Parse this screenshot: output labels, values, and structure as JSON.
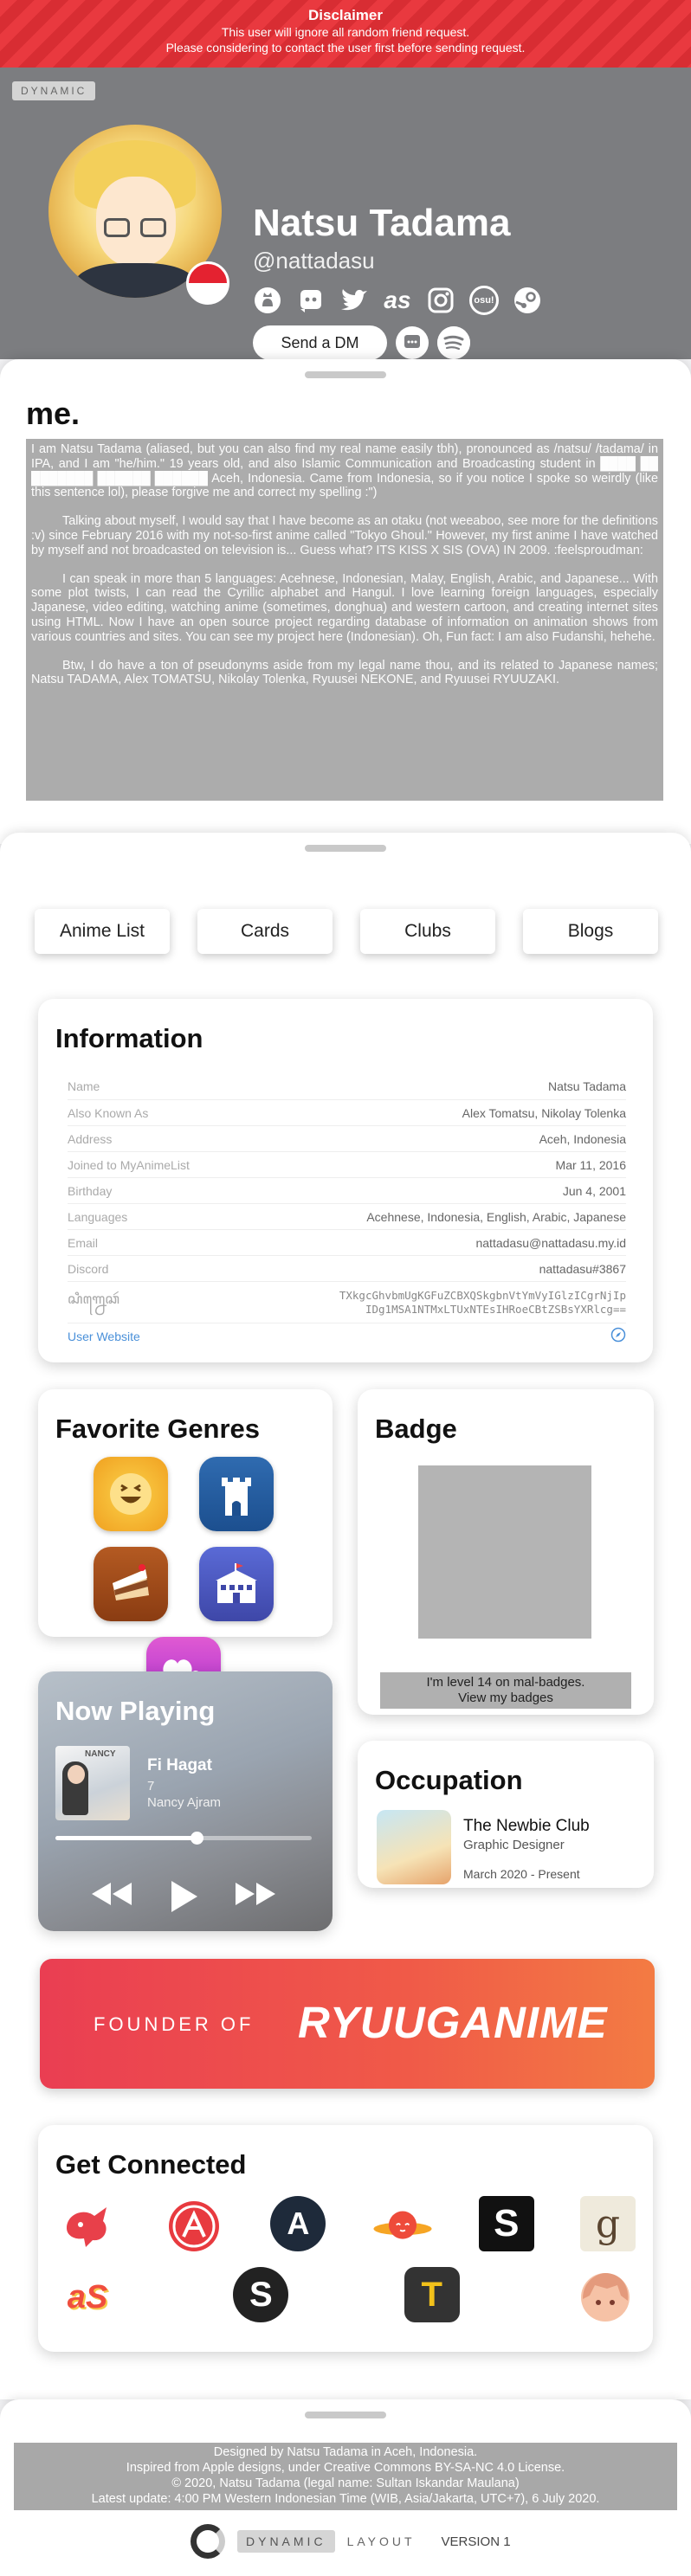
{
  "disclaimer": {
    "title": "Disclaimer",
    "line1": "This user will ignore all random friend request.",
    "line2": "Please considering to contact the user first before sending request."
  },
  "hero": {
    "badge": "DYNAMIC",
    "name": "Natsu Tadama",
    "handle": "@nattadasu",
    "dm_label": "Send a DM",
    "socials": [
      "github-icon",
      "discord-icon",
      "twitter-icon",
      "lastfm-icon",
      "instagram-icon",
      "osu-icon",
      "steam-icon"
    ],
    "osu_label": "osu!",
    "lastfm_label": "as"
  },
  "me": {
    "title": "me.",
    "p1": "I am Natsu Tadama (aliased, but you can also find my real name easily tbh), pronounced as /natsu/ /tadama/ in IPA, and I am \"he/him.\" 19 years old, and also Islamic Communication and Broadcasting student in ████ ██ ███████ ██████ ██████ Aceh, Indonesia. Came from Indonesia, so if you notice I spoke so weirdly (like this sentence lol), please forgive me and correct my spelling :\")",
    "p2": "Talking about myself, I would say that I have become as an otaku (not weeaboo, see more for the definitions :v) since February 2016 with my not-so-first anime called \"Tokyo Ghoul.\" However, my first anime I have watched by myself and not broadcasted on television is... Guess what? ITS KISS X SIS (OVA) IN 2009. :feelsproudman:",
    "p3": "I can speak in more than 5 languages: Acehnese, Indonesian, Malay, English, Arabic, and Japanese... With some plot twists, I can read the Cyrillic alphabet and Hangul. I love learning foreign languages, especially Japanese, video editing, watching anime (sometimes, donghua) and western cartoon, and creating internet sites using HTML. Now I have an open source project regarding database of information on animation shows from various countries and sites. You can see my project here (Indonesian). Oh, Fun fact: I am also Fudanshi, hehehe.",
    "p4": "Btw, I do have a ton of pseudonyms aside from my legal name thou, and its related to Japanese names; Natsu TADAMA, Alex TOMATSU, Nikolay Tolenka, Ryuusei NEKONE, and Ryuusei RYUUZAKI."
  },
  "tabs": [
    "Anime List",
    "Cards",
    "Clubs",
    "Blogs"
  ],
  "information": {
    "title": "Information",
    "rows": [
      {
        "label": "Name",
        "value": "Natsu Tadama"
      },
      {
        "label": "Also Known As",
        "value": "Alex Tomatsu, Nikolay Tolenka"
      },
      {
        "label": "Address",
        "value": "Aceh, Indonesia"
      },
      {
        "label": "Joined to MyAnimeList",
        "value": "Mar 11, 2016"
      },
      {
        "label": "Birthday",
        "value": "Jun 4, 2001"
      },
      {
        "label": "Languages",
        "value": "Acehnese, Indonesia, English, Arabic, Japanese"
      },
      {
        "label": "Email",
        "value": "nattadasu@nattadasu.my.id"
      },
      {
        "label": "Discord",
        "value": "nattadasu#3867"
      }
    ],
    "sig_label": "ꦱꦶꦒ꧀ꦤꦺꦕꦂ",
    "sig_line1": "TXkgcGhvbmUgKGFuZCBXQSkgbnVtYmVyIGlzICgrNjIp",
    "sig_line2": "IDg1MSA1NTMxLTUxNTEsIHRoeCBtZSBsYXRlcg==",
    "website_label": "User Website"
  },
  "genres": {
    "title": "Favorite Genres",
    "icons": [
      "comedy-icon",
      "fantasy-icon",
      "slice-of-life-icon",
      "school-icon",
      "romance-icon"
    ]
  },
  "badge": {
    "title": "Badge",
    "caption_line1": "I'm level 14 on mal-badges.",
    "caption_line2": "View my badges"
  },
  "now_playing": {
    "title": "Now Playing",
    "song": "Fi Hagat",
    "track": "7",
    "artist": "Nancy Ajram",
    "cover_text": "NANCY",
    "progress": 0.55
  },
  "occupation": {
    "title": "Occupation",
    "club": "The Newbie Club",
    "role": "Graphic Designer",
    "dates": "March 2020 - Present"
  },
  "founder": {
    "label": "FOUNDER OF",
    "brand": "RYUUGANIME"
  },
  "connected": {
    "title": "Get Connected",
    "icons_row1": [
      "myanimelist-icon",
      "kitsu-icon",
      "anilist-icon",
      "annict-icon",
      "simkl-icon",
      "goodreads-icon"
    ],
    "icons_row2": [
      "animeplanet-icon",
      "shikimori-icon",
      "trakt-icon",
      "anime-character-icon"
    ],
    "g_label": "g",
    "as_label": "aS",
    "s_label": "S",
    "t_label": "T",
    "a_label": "A"
  },
  "footer": {
    "line1": "Designed by Natsu Tadama in Aceh, Indonesia.",
    "line2": "Inspired from Apple designs, under Creative Commons BY-SA-NC 4.0 License.",
    "line3": "© 2020, Natsu Tadama (legal name: Sultan Iskandar Maulana)",
    "line4": "Latest update: 4:00 PM Western Indonesian Time (WIB, Asia/Jakarta, UTC+7), 6 July 2020.",
    "dynamic": "DYNAMIC",
    "layout": "LAYOUT",
    "version": "VERSION 1"
  }
}
